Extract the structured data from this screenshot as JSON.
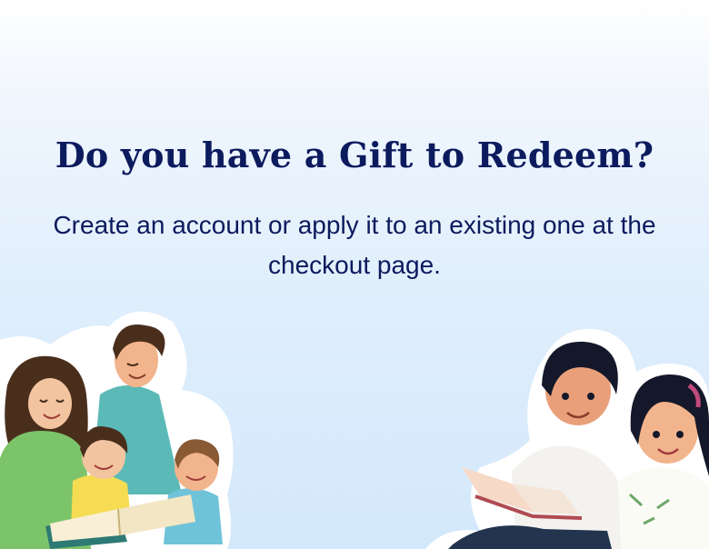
{
  "banner": {
    "headline": "Do you have a Gift to Redeem?",
    "subtext": "Create an account or apply it to an existing one at the checkout page."
  },
  "colors": {
    "text": "#0c1a5e",
    "background_top": "#ffffff",
    "background_bottom": "#d3e8fb"
  },
  "illustrations": {
    "left": "family-reading-illustration",
    "right": "kids-reading-illustration"
  }
}
